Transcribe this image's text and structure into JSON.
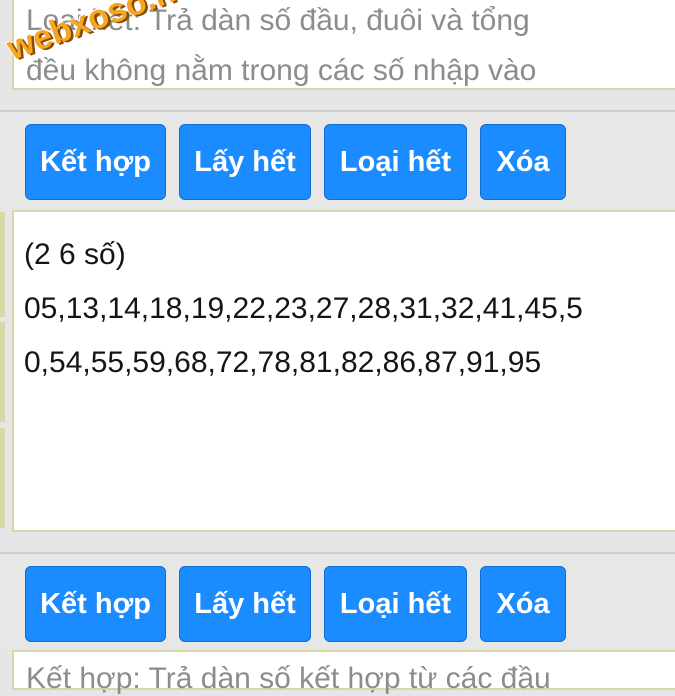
{
  "top_panel": {
    "line1": "Loại hết: Trả dàn số đầu, đuôi và tổng",
    "line2": "đều không nằm trong các số nhập vào"
  },
  "toolbar1": {
    "combine_label": "Kết hợp",
    "take_all_label": "Lấy hết",
    "remove_all_label": "Loại hết",
    "clear_label": "Xóa"
  },
  "result": {
    "header": "(2 6 số)",
    "line1": "05,13,14,18,19,22,23,27,28,31,32,41,45,5",
    "line2": "0,54,55,59,68,72,78,81,82,86,87,91,95"
  },
  "toolbar2": {
    "combine_label": "Kết hợp",
    "take_all_label": "Lấy hết",
    "remove_all_label": "Loại hết",
    "clear_label": "Xóa"
  },
  "bottom_panel": {
    "text": "Kết hợp: Trả dàn số kết hợp từ các đầu"
  },
  "watermark": {
    "text": "webxoso.net"
  },
  "colors": {
    "button_bg": "#1a8cff",
    "panel_border": "#d8d8a6",
    "watermark": "#f5a623"
  }
}
